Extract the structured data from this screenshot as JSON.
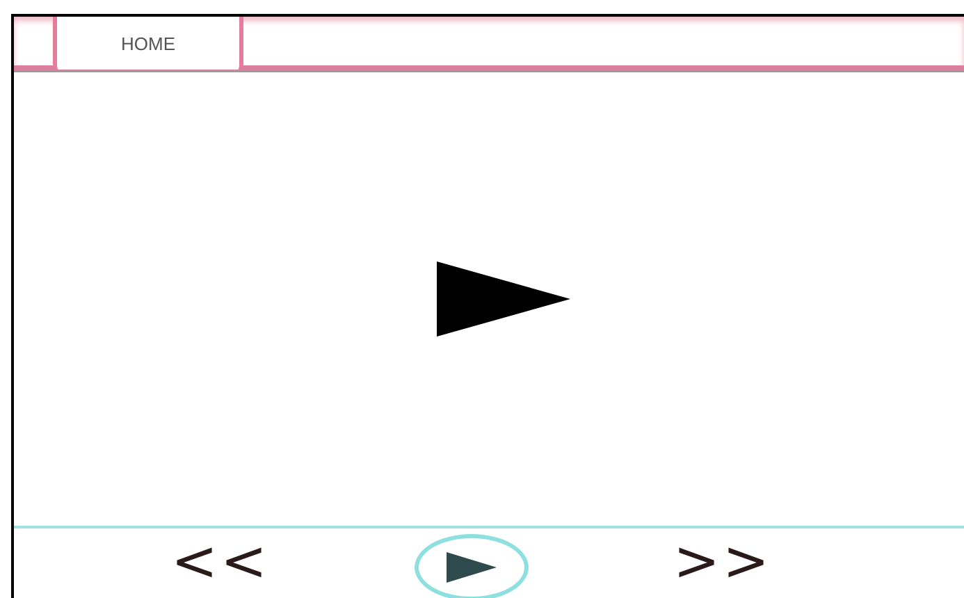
{
  "tabs": [
    {
      "label": "HOME"
    }
  ],
  "controls": {
    "previous": "<<",
    "next": ">>"
  }
}
